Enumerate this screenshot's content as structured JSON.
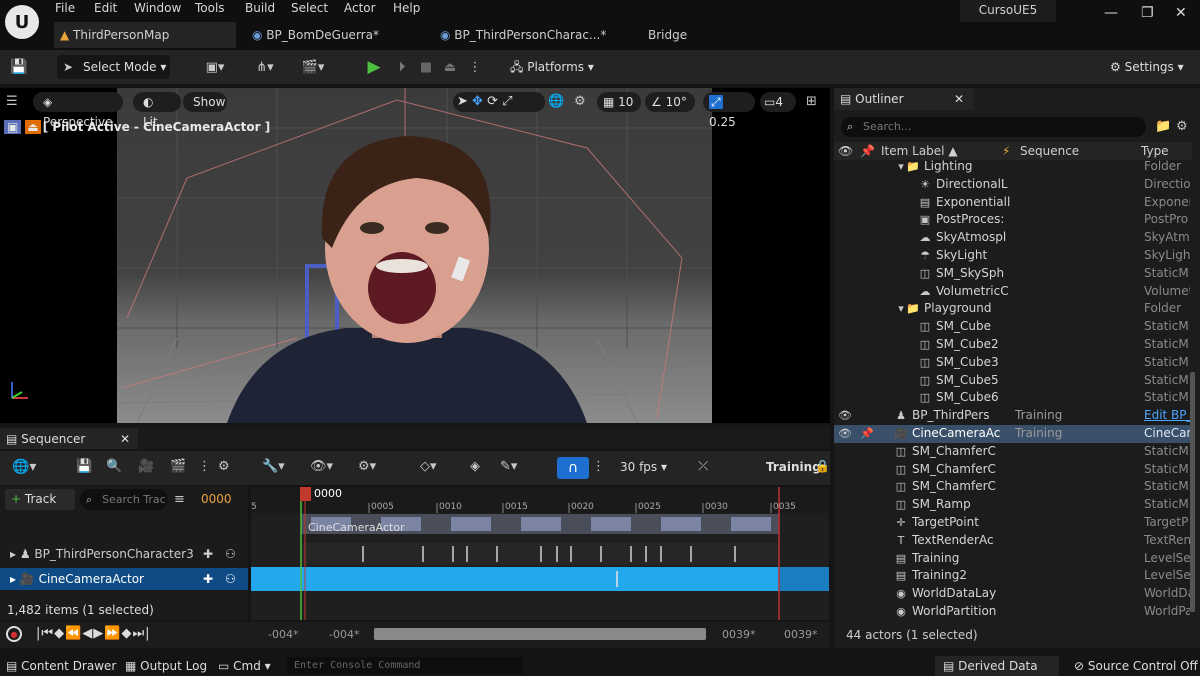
{
  "menu": {
    "items": [
      "File",
      "Edit",
      "Window",
      "Tools",
      "Build",
      "Select",
      "Actor",
      "Help"
    ]
  },
  "project_name": "CursoUE5",
  "tabs": [
    {
      "label": "ThirdPersonMap"
    },
    {
      "label": "BP_BomDeGuerra*"
    },
    {
      "label": "BP_ThirdPersonCharac...*"
    },
    {
      "label": "Bridge"
    }
  ],
  "toolbar": {
    "select_mode": "Select Mode",
    "platforms": "Platforms",
    "settings": "Settings"
  },
  "viewport": {
    "perspective": "Perspective",
    "lit": "Lit",
    "show": "Show",
    "grid_snap": "10",
    "rot_snap": "10°",
    "scale_snap": "0.25",
    "cam_speed": "4",
    "pilot_label": "[ Pilot Active - CineCameraActor ]"
  },
  "sequencer": {
    "tab": "Sequencer",
    "track_button": "Track",
    "search_placeholder": "Search Trac",
    "current_frame": "0000",
    "fps": "30 fps",
    "sequence_name": "Training",
    "playhead_label": "0000",
    "ruler": [
      "5",
      "0005",
      "0010",
      "0015",
      "0020",
      "0025",
      "0030",
      "0035"
    ],
    "tracks": [
      {
        "label": "BP_ThirdPersonCharacter3"
      },
      {
        "label": "CineCameraActor"
      }
    ],
    "thumb_track_label": "CineCameraActor",
    "items_count": "1,482 items (1 selected)",
    "range_start": "-004*",
    "range_start2": "-004*",
    "range_end": "0039*",
    "range_end2": "0039*"
  },
  "outliner": {
    "tab": "Outliner",
    "search_placeholder": "Search...",
    "columns": {
      "label": "Item Label",
      "sequence": "Sequence",
      "type": "Type"
    },
    "rows": [
      {
        "label": "Lighting",
        "type": "Folder",
        "seq": "",
        "icon": "folder-icon"
      },
      {
        "label": "DirectionalL",
        "type": "Directio",
        "seq": "",
        "icon": "sun-icon"
      },
      {
        "label": "Exponentiall",
        "type": "Exponer",
        "seq": "",
        "icon": "fog-icon"
      },
      {
        "label": "PostProces:",
        "type": "PostPro",
        "seq": "",
        "icon": "postprocess-icon"
      },
      {
        "label": "SkyAtmospl",
        "type": "SkyAtm",
        "seq": "",
        "icon": "sky-icon"
      },
      {
        "label": "SkyLight",
        "type": "SkyLigh",
        "seq": "",
        "icon": "skylight-icon"
      },
      {
        "label": "SM_SkySph",
        "type": "StaticM",
        "seq": "",
        "icon": "mesh-icon"
      },
      {
        "label": "VolumetricC",
        "type": "Volumet",
        "seq": "",
        "icon": "cloud-icon"
      },
      {
        "label": "Playground",
        "type": "Folder",
        "seq": "",
        "icon": "folder-icon"
      },
      {
        "label": "SM_Cube",
        "type": "StaticM",
        "seq": "",
        "icon": "mesh-icon"
      },
      {
        "label": "SM_Cube2",
        "type": "StaticM",
        "seq": "",
        "icon": "mesh-icon"
      },
      {
        "label": "SM_Cube3",
        "type": "StaticM",
        "seq": "",
        "icon": "mesh-icon"
      },
      {
        "label": "SM_Cube5",
        "type": "StaticM",
        "seq": "",
        "icon": "mesh-icon"
      },
      {
        "label": "SM_Cube6",
        "type": "StaticM",
        "seq": "",
        "icon": "mesh-icon"
      },
      {
        "label": "BP_ThirdPers",
        "type": "Edit BP_",
        "seq": "Training",
        "icon": "pawn-icon"
      },
      {
        "label": "CineCameraAc",
        "type": "CineCan",
        "seq": "Training",
        "icon": "camera-icon"
      },
      {
        "label": "SM_ChamferC",
        "type": "StaticM",
        "seq": "",
        "icon": "mesh-icon"
      },
      {
        "label": "SM_ChamferC",
        "type": "StaticM",
        "seq": "",
        "icon": "mesh-icon"
      },
      {
        "label": "SM_ChamferC",
        "type": "StaticM",
        "seq": "",
        "icon": "mesh-icon"
      },
      {
        "label": "SM_Ramp",
        "type": "StaticM",
        "seq": "",
        "icon": "mesh-icon"
      },
      {
        "label": "TargetPoint",
        "type": "TargetP",
        "seq": "",
        "icon": "target-icon"
      },
      {
        "label": "TextRenderAc",
        "type": "TextRen",
        "seq": "",
        "icon": "text-icon"
      },
      {
        "label": "Training",
        "type": "LevelSe",
        "seq": "",
        "icon": "sequence-icon"
      },
      {
        "label": "Training2",
        "type": "LevelSe",
        "seq": "",
        "icon": "sequence-icon"
      },
      {
        "label": "WorldDataLay",
        "type": "WorldDa",
        "seq": "",
        "icon": "world-icon"
      },
      {
        "label": "WorldPartition",
        "type": "WorldPa",
        "seq": "",
        "icon": "world-icon"
      }
    ],
    "footer": "44 actors (1 selected)"
  },
  "status": {
    "content_drawer": "Content Drawer",
    "output_log": "Output Log",
    "cmd": "Cmd",
    "console_placeholder": "Enter Console Command",
    "derived_data": "Derived Data",
    "source_control": "Source Control Off"
  }
}
